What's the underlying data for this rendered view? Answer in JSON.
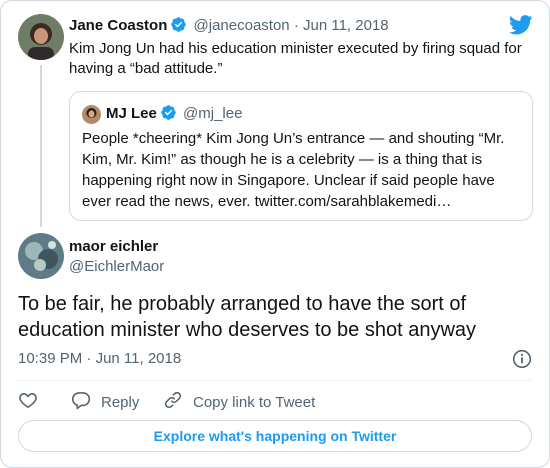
{
  "parent_tweet": {
    "name": "Jane Coaston",
    "handle": "@janecoaston",
    "separator": "·",
    "date": "Jun 11, 2018",
    "text": "Kim Jong Un had his education minister executed by firing squad for having a “bad attitude.”",
    "verified_icon": "verified-badge-icon",
    "avatar_colors": {
      "bg": "#6f7d66",
      "hair": "#3a2a22",
      "skin": "#c9967c"
    }
  },
  "quoted_tweet": {
    "name": "MJ Lee",
    "handle": "@mj_lee",
    "text": "People *cheering* Kim Jong Un’s entrance — and shouting “Mr. Kim, Mr. Kim!” as though he is a celebrity — is a thing that is happening right now in Singapore. Unclear if said people have ever read the news, ever. twitter.com/sarahblakemedi…",
    "avatar_colors": {
      "bg": "#b08a6a",
      "hair": "#2a1c14"
    }
  },
  "main_tweet": {
    "name": "maor eichler",
    "handle": "@EichlerMaor",
    "text": "To be fair, he probably arranged to have the sort of education minister who deserves to be shot anyway",
    "time": "10:39 PM",
    "separator": "·",
    "date": "Jun 11, 2018",
    "avatar_colors": {
      "bg": "#5f7c86",
      "accent": "#9fb7b8"
    }
  },
  "actions": {
    "reply_label": "Reply",
    "copy_link_label": "Copy link to Tweet"
  },
  "footer": {
    "explore_label": "Explore what's happening on Twitter"
  },
  "colors": {
    "brand_blue": "#1d9bf0",
    "text_primary": "#0f1419",
    "text_muted": "#536471",
    "border": "#cfd9de",
    "heart_red": "#f91880"
  },
  "icons": [
    "twitter-bird-icon",
    "verified-badge-icon",
    "info-icon",
    "heart-icon",
    "reply-icon",
    "link-icon"
  ]
}
